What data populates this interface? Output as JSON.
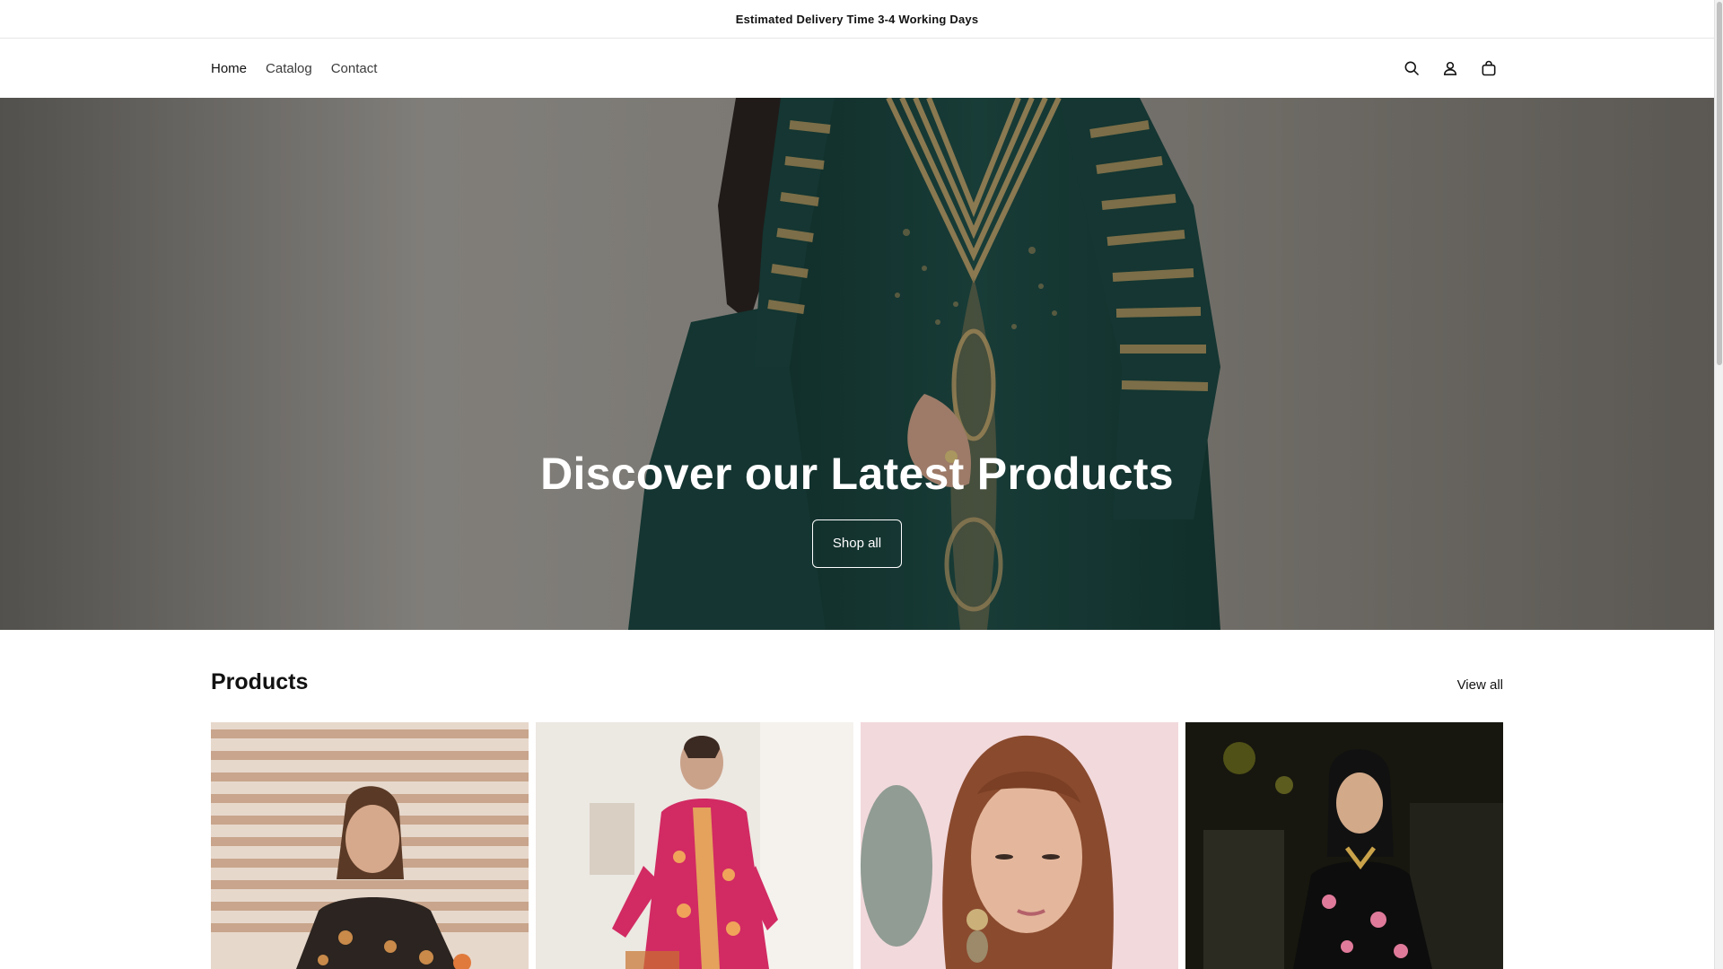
{
  "announcement": {
    "text": "Estimated Delivery Time 3-4 Working Days"
  },
  "nav": {
    "items": [
      {
        "label": "Home"
      },
      {
        "label": "Catalog"
      },
      {
        "label": "Contact"
      }
    ]
  },
  "header_icons": [
    "search-icon",
    "account-icon",
    "cart-icon"
  ],
  "hero": {
    "title": "Discover our Latest Products",
    "button_label": "Shop all",
    "garment_color": "#1d4a44",
    "embroidery_color": "#b79a62"
  },
  "products": {
    "title": "Products",
    "view_all_label": "View all",
    "cards": [
      {
        "image": "model-patterned-black-dress"
      },
      {
        "image": "model-pink-embroidered-dress"
      },
      {
        "image": "model-portrait-earrings"
      },
      {
        "image": "model-black-floral-dress"
      }
    ]
  },
  "colors": {
    "text": "#121212",
    "background": "#ffffff",
    "border": "#e6e6e6"
  }
}
